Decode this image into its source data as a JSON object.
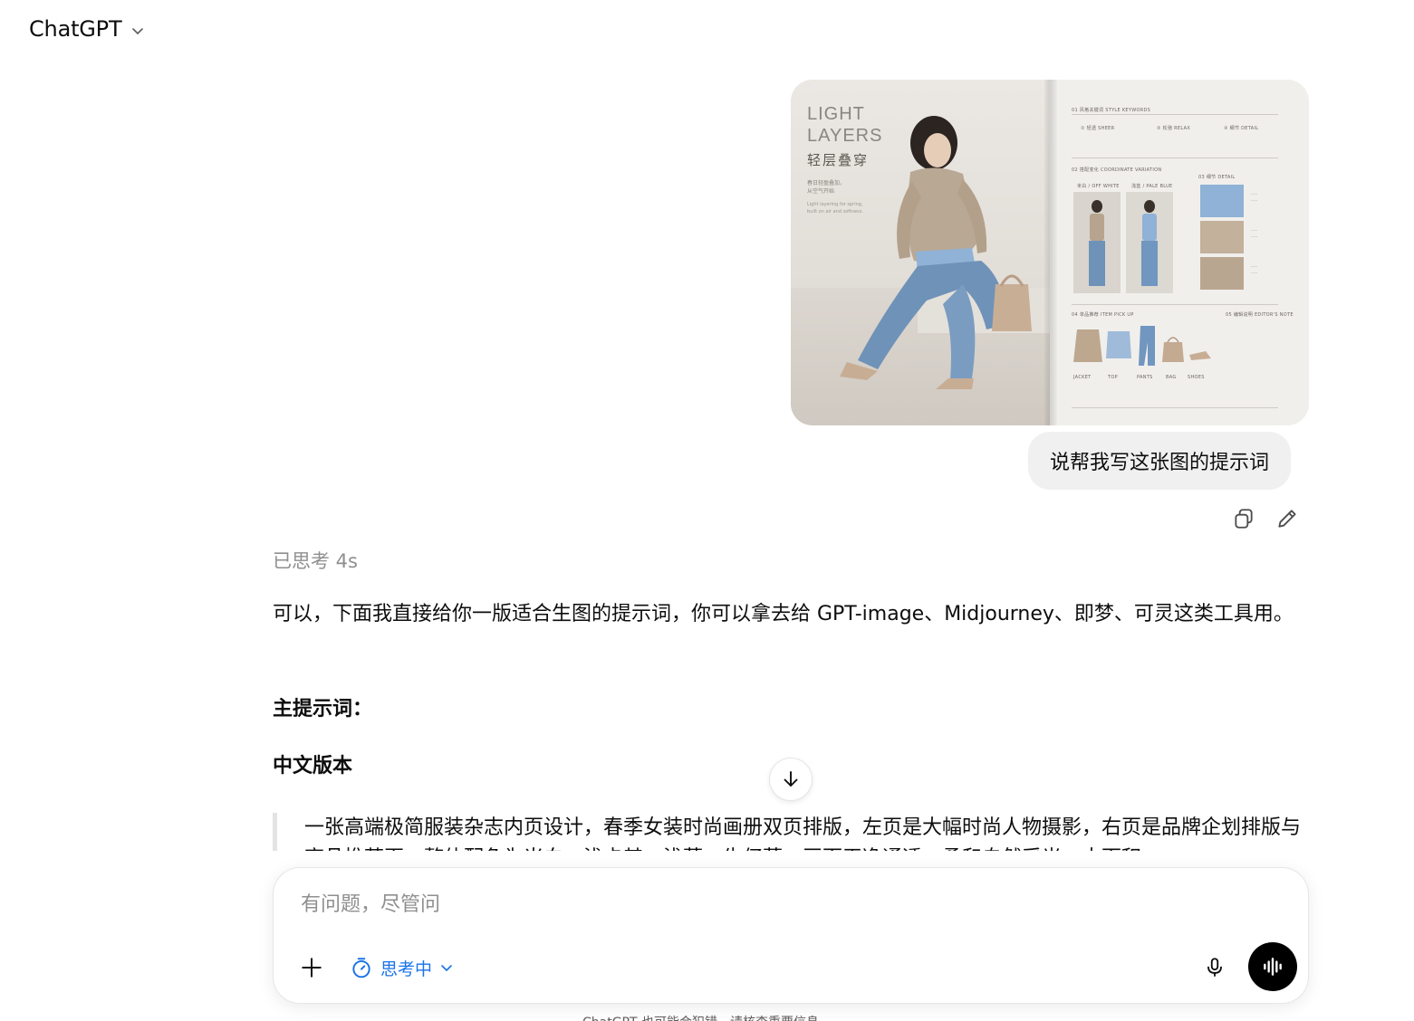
{
  "header": {
    "title": "ChatGPT",
    "chevron_icon": "chevron-down-icon"
  },
  "user_message": {
    "image": {
      "title_lines": [
        "LIGHT",
        "LAYERS"
      ],
      "title_cn": "轻层叠穿",
      "caption_cn": "春日轻盈叠加，\n从空气开始",
      "caption_en": "Light layering for spring,\nbuilt on air and softness.",
      "sections": [
        "01 风格关键词 STYLE KEYWORDS",
        "02 搭配变化 COORDINATE VARIATION",
        "03 细节 DETAIL",
        "04 单品推荐 ITEM PICK UP",
        "05 编辑说明 EDITOR'S NOTE"
      ],
      "keywords": [
        "① 轻透 SHEER",
        "② 松弛 RELAX",
        "③ 细节 DETAIL"
      ],
      "variations": [
        "米白 / OFF WHITE",
        "浅蓝 / PALE BLUE"
      ],
      "items": [
        "JACKET",
        "TOP",
        "PANTS",
        "BAG",
        "SHOES"
      ]
    },
    "text": "说帮我写这张图的提示词",
    "actions": {
      "copy": "copy-icon",
      "edit": "pencil-icon"
    }
  },
  "assistant": {
    "thought": "已思考 4s",
    "answer": "可以，下面我直接给你一版适合生图的提示词，你可以拿去给 GPT-image、Midjourney、即梦、可灵这类工具用。",
    "heading_main": "主提示词：",
    "heading_cn": "中文版本",
    "quote": "一张高端极简服装杂志内页设计，春季女装时尚画册双页排版，左页是大幅时尚人物摄影，右页是品牌企划排版与商品推荐页，整体配色为米白、浅卡其、浅蓝、牛仔蓝，画面干净通透，柔和自然采光，大面积"
  },
  "composer": {
    "placeholder": "有问题，尽管问",
    "mode_label": "思考中",
    "icons": {
      "plus": "plus-icon",
      "timer": "timer-icon",
      "mic": "microphone-icon",
      "voice": "voice-waveform-icon"
    }
  },
  "footer": {
    "disclaimer": "ChatGPT 也可能会犯错。请核查重要信息。"
  }
}
